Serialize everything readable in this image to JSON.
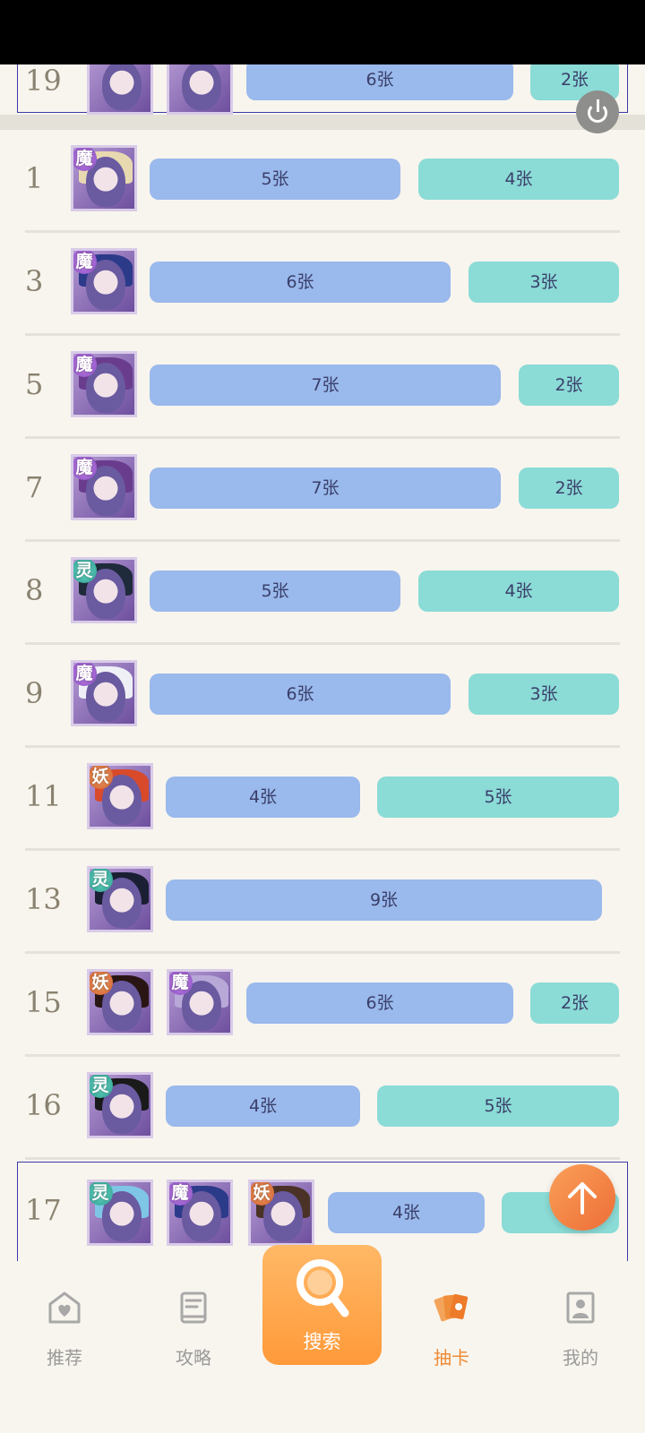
{
  "rows": [
    {
      "num": "1",
      "bars": [
        "5张",
        "4张"
      ]
    },
    {
      "num": "3",
      "bars": [
        "6张",
        "3张"
      ]
    },
    {
      "num": "5",
      "bars": [
        "7张",
        "2张"
      ]
    },
    {
      "num": "7",
      "bars": [
        "7张",
        "2张"
      ]
    },
    {
      "num": "8",
      "bars": [
        "5张",
        "4张"
      ]
    },
    {
      "num": "9",
      "bars": [
        "6张",
        "3张"
      ]
    },
    {
      "num": "11",
      "bars": [
        "4张",
        "5张"
      ]
    },
    {
      "num": "13",
      "bars": [
        "9张"
      ]
    },
    {
      "num": "15",
      "bars": [
        "6张",
        "2张"
      ]
    },
    {
      "num": "16",
      "bars": [
        "4张",
        "5张"
      ]
    },
    {
      "num": "17",
      "bars": [
        "4张",
        "3"
      ]
    }
  ],
  "top_row": {
    "num": "19",
    "bars": [
      "6张",
      "2张"
    ]
  },
  "tags": {
    "mo": "魔",
    "ling": "灵",
    "yao": "妖"
  },
  "tabs": {
    "home": "推荐",
    "guide": "攻略",
    "search": "搜索",
    "draw": "抽卡",
    "mine": "我的"
  },
  "colors": {
    "bar_blue": "#9ab9ec",
    "bar_teal": "#8bdbd6",
    "accent_orange": "#ee8a35",
    "highlight_border": "#3a3aa8"
  }
}
